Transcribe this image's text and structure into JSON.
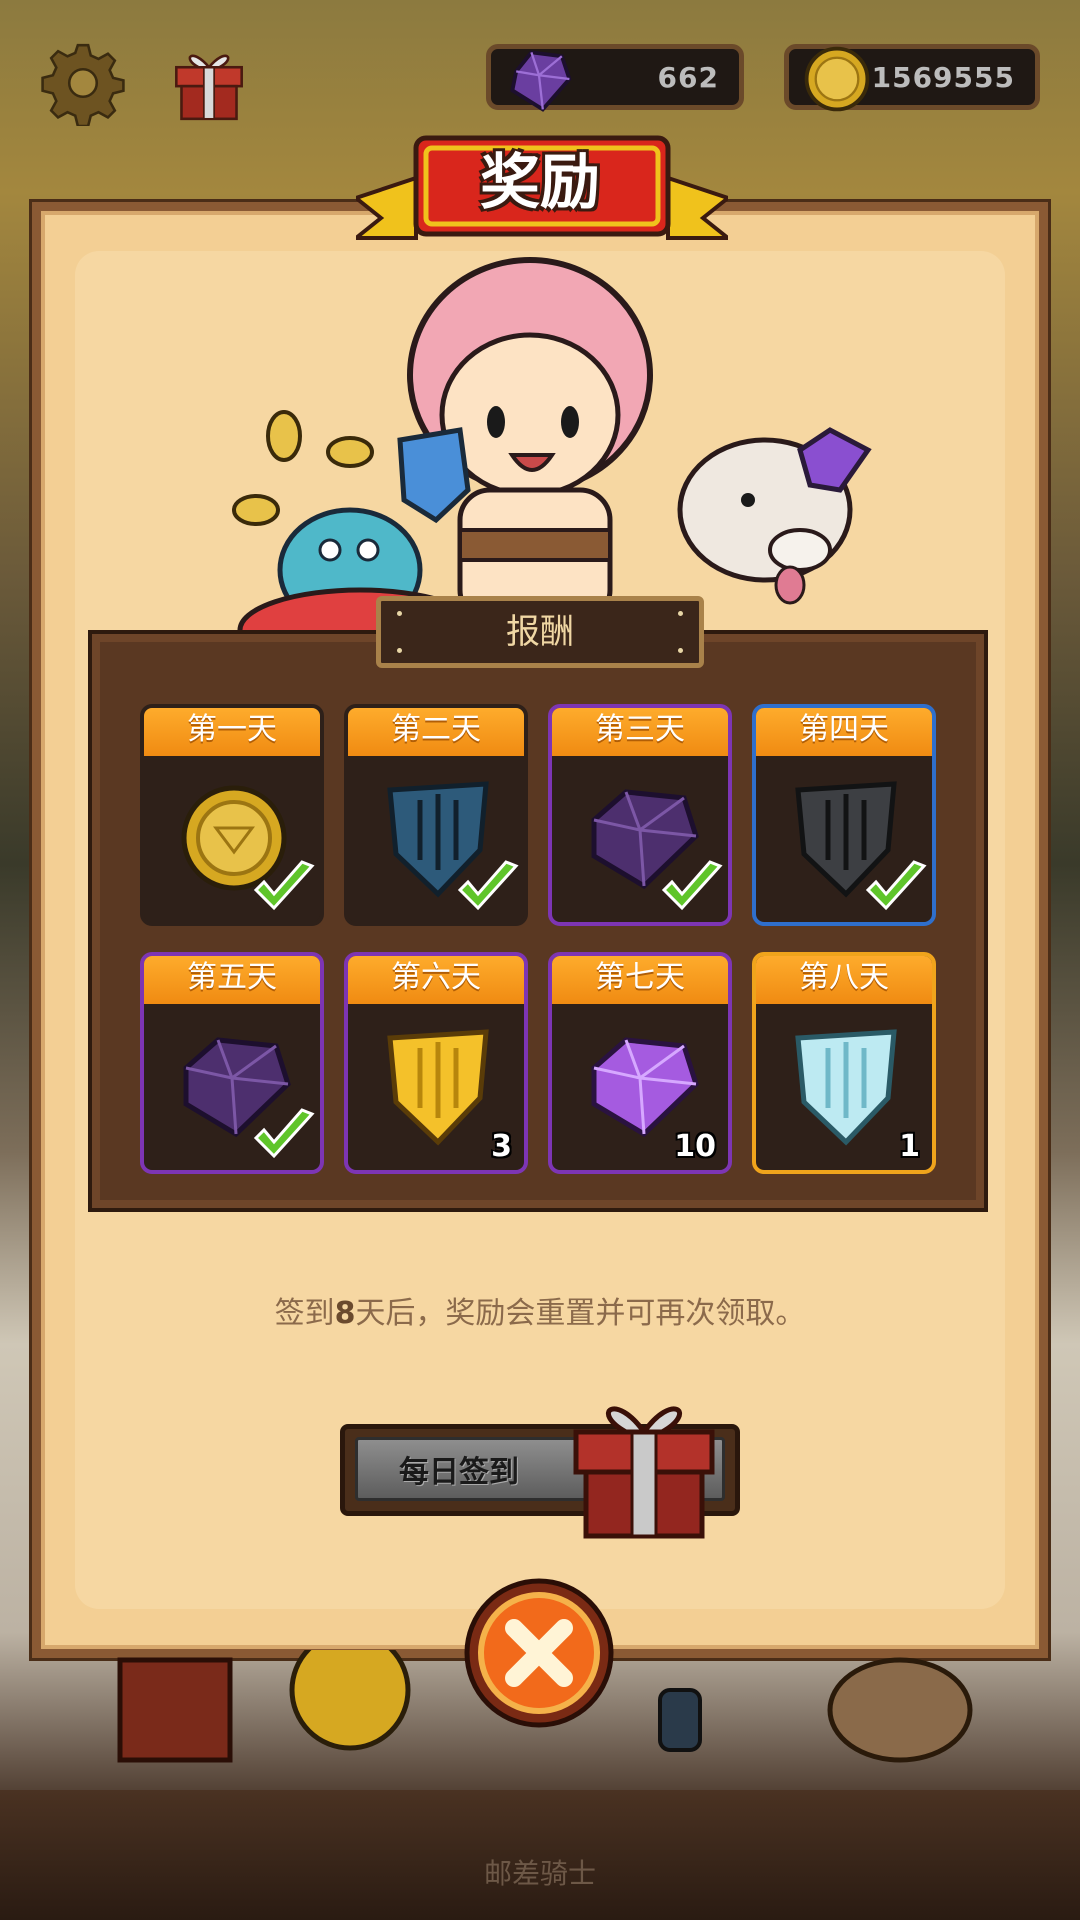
{
  "app_name": "邮差骑士",
  "currency": {
    "gems": "662",
    "coins": "1569555"
  },
  "dialog": {
    "title": "奖励",
    "board_title": "报酬",
    "days": [
      {
        "label": "第一天",
        "item": "gold-coin",
        "claimed": true,
        "qty": ""
      },
      {
        "label": "第二天",
        "item": "blue-shield",
        "claimed": true,
        "qty": ""
      },
      {
        "label": "第三天",
        "item": "purple-gem",
        "claimed": true,
        "qty": ""
      },
      {
        "label": "第四天",
        "item": "gray-shield",
        "claimed": true,
        "qty": ""
      },
      {
        "label": "第五天",
        "item": "purple-gem",
        "claimed": true,
        "qty": ""
      },
      {
        "label": "第六天",
        "item": "gold-shield",
        "claimed": false,
        "qty": "3"
      },
      {
        "label": "第七天",
        "item": "violet-gem",
        "claimed": false,
        "qty": "10"
      },
      {
        "label": "第八天",
        "item": "ice-shield",
        "claimed": false,
        "qty": "1"
      }
    ],
    "note_prefix": "签到",
    "note_days": "8",
    "note_suffix": "天后，奖励会重置并可再次领取。",
    "sign_button": "每日签到"
  },
  "colors": {
    "accent_orange": "#f08b12",
    "ribbon_red": "#d9261c",
    "panel": "#f3cf94",
    "check_green": "#5fc52a"
  }
}
